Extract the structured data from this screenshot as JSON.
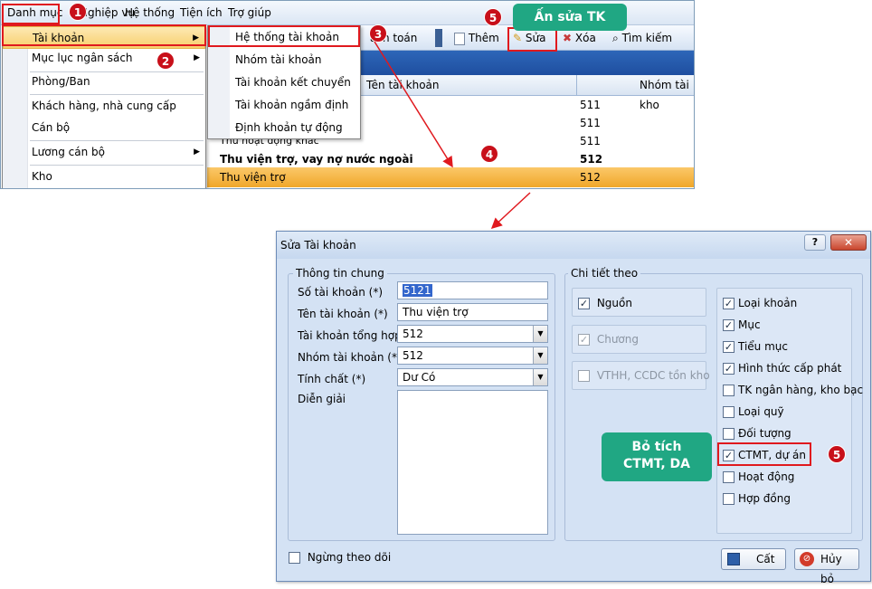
{
  "menubar": {
    "items": [
      "Danh mục",
      "Nghiệp vụ",
      "Hệ thống",
      "Tiện ích",
      "Trợ giúp"
    ]
  },
  "toolbar": {
    "partial_label": "ách toán",
    "them": "Thêm",
    "sua": "Sửa",
    "xoa": "Xóa",
    "timkiem": "Tìm kiếm"
  },
  "grid": {
    "col_name": "Tên tài khoản",
    "col_group": "Nhóm tài kho",
    "rows": [
      {
        "name": "",
        "group": "511",
        "bold": false,
        "selected": false
      },
      {
        "name": "",
        "group": "511",
        "bold": false,
        "selected": false
      },
      {
        "name": "Thu hoạt động khác",
        "group": "511",
        "bold": false,
        "selected": false
      },
      {
        "name": "Thu viện trợ, vay nợ nước ngoài",
        "group": "512",
        "bold": true,
        "selected": false
      },
      {
        "name": "Thu viện trợ",
        "group": "512",
        "bold": false,
        "selected": true
      }
    ]
  },
  "menu_danhmuc": {
    "items": [
      "Tài khoản",
      "Mục lục ngân sách",
      "Phòng/Ban",
      "Khách hàng, nhà cung cấp",
      "Cán bộ",
      "Lương cán bộ",
      "Kho"
    ]
  },
  "menu_taikhoan": {
    "items": [
      "Hệ thống tài khoản",
      "Nhóm tài khoản",
      "Tài khoản kết chuyển",
      "Tài khoản ngầm định",
      "Định khoản tự động"
    ]
  },
  "badges": {
    "b1": "1",
    "b2": "2",
    "b3": "3",
    "b4": "4",
    "b5a": "5",
    "b5b": "5"
  },
  "callouts": {
    "top": "Ấn sửa TK",
    "side_line1": "Bỏ tích",
    "side_line2": "CTMT, DA"
  },
  "dialog": {
    "title": "Sửa Tài khoản",
    "help": "?",
    "thongtin_title": "Thông tin chung",
    "so_tk_label": "Số tài khoản (*)",
    "so_tk_value": "5121",
    "ten_tk_label": "Tên tài khoản (*)",
    "ten_tk_value": "Thu viện trợ",
    "tk_tonghop_label": "Tài khoản tổng hợp",
    "tk_tonghop_value": "512",
    "nhom_tk_label": "Nhóm tài khoản (*)",
    "nhom_tk_value": "512",
    "tinhchat_label": "Tính chất (*)",
    "tinhchat_value": "Dư Có",
    "diengiai_label": "Diễn giải",
    "chitiet_title": "Chi tiết theo",
    "left_checks": [
      {
        "label": "Nguồn",
        "checked": true,
        "disabled": false
      },
      {
        "label": "Chương",
        "checked": true,
        "disabled": true
      },
      {
        "label": "VTHH, CCDC tồn kho",
        "checked": false,
        "disabled": true
      }
    ],
    "right_checks": [
      {
        "label": "Loại khoản",
        "checked": true
      },
      {
        "label": "Mục",
        "checked": true
      },
      {
        "label": "Tiểu mục",
        "checked": true
      },
      {
        "label": "Hình thức cấp phát",
        "checked": true
      },
      {
        "label": "TK ngân hàng, kho bạc",
        "checked": false
      },
      {
        "label": "Loại quỹ",
        "checked": false
      },
      {
        "label": "Đối tượng",
        "checked": false
      },
      {
        "label": "CTMT, dự án",
        "checked": true
      },
      {
        "label": "Hoạt động",
        "checked": false
      },
      {
        "label": "Hợp đồng",
        "checked": false
      }
    ],
    "ngung_label": "Ngừng theo dõi",
    "cat_label": "Cất",
    "huybo_label": "Hủy bỏ"
  },
  "colors": {
    "accent_red": "#e0191e",
    "callout_green": "#20a783",
    "selected_row": "#f5b335"
  }
}
